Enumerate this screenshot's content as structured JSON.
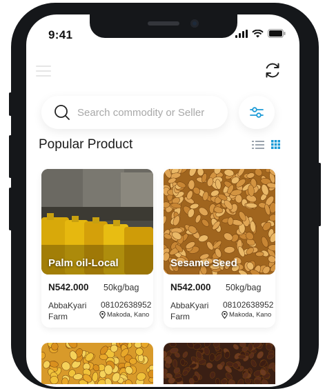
{
  "status_bar": {
    "time": "9:41"
  },
  "header": {
    "menu_icon": "hamburger-icon",
    "refresh_icon": "refresh-icon"
  },
  "search": {
    "placeholder": "Search commodity or Seller",
    "icon": "search-icon"
  },
  "filter": {
    "icon": "filter-sliders-icon"
  },
  "section": {
    "title": "Popular Product",
    "active_view": "grid"
  },
  "colors": {
    "accent": "#1a9ad6",
    "text": "#1a1a1a",
    "placeholder": "#a8a8a8"
  },
  "products": [
    {
      "name": "Palm oil-Local",
      "price": "N542.000",
      "unit": "50kg/bag",
      "seller": "AbbaKyari Farm",
      "phone": "08102638952",
      "location": "Makoda, Kano"
    },
    {
      "name": "Sesame Seed",
      "price": "N542.000",
      "unit": "50kg/bag",
      "seller": "AbbaKyari Farm",
      "phone": "08102638952",
      "location": "Makoda, Kano"
    }
  ]
}
